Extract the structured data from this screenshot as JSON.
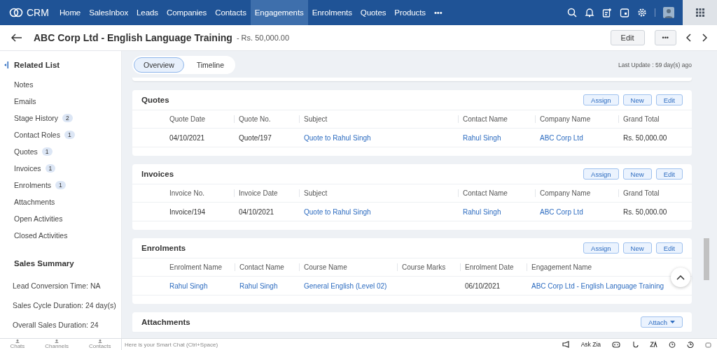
{
  "nav": {
    "brand": "CRM",
    "items": [
      {
        "label": "Home",
        "selected": false
      },
      {
        "label": "SalesInbox",
        "selected": false
      },
      {
        "label": "Leads",
        "selected": false
      },
      {
        "label": "Companies",
        "selected": false
      },
      {
        "label": "Contacts",
        "selected": false
      },
      {
        "label": "Engagements",
        "selected": true
      },
      {
        "label": "Enrolments",
        "selected": false
      },
      {
        "label": "Quotes",
        "selected": false
      },
      {
        "label": "Products",
        "selected": false
      }
    ],
    "more": "•••"
  },
  "header": {
    "title": "ABC Corp Ltd - English Language Training",
    "amount": "- Rs. 50,000.00",
    "edit": "Edit",
    "more": "•••"
  },
  "sidebar": {
    "title": "Related List",
    "items": [
      {
        "label": "Notes"
      },
      {
        "label": "Emails"
      },
      {
        "label": "Stage History",
        "count": "2"
      },
      {
        "label": "Contact Roles",
        "count": "1"
      },
      {
        "label": "Quotes",
        "count": "1"
      },
      {
        "label": "Invoices",
        "count": "1"
      },
      {
        "label": "Enrolments",
        "count": "1"
      },
      {
        "label": "Attachments"
      },
      {
        "label": "Open Activities"
      },
      {
        "label": "Closed Activities"
      }
    ],
    "summary_title": "Sales Summary",
    "summary": [
      "Lead Conversion Time: NA",
      "Sales Cycle Duration: 24 day(s)",
      "Overall Sales Duration: 24"
    ]
  },
  "tabs": [
    {
      "label": "Overview",
      "selected": true
    },
    {
      "label": "Timeline",
      "selected": false
    }
  ],
  "last_update": "Last Update : 59 day(s) ago",
  "sections": [
    {
      "title": "Quotes",
      "buttons": [
        "Assign",
        "New",
        "Edit"
      ],
      "columns": [
        "Quote Date",
        "Quote No.",
        "Subject",
        "Contact Name",
        "Company Name",
        "Grand Total"
      ],
      "rows": [
        [
          {
            "text": "04/10/2021",
            "kind": "text"
          },
          {
            "text": "Quote/197",
            "kind": "text"
          },
          {
            "text": "Quote to Rahul Singh",
            "kind": "link"
          },
          {
            "text": "Rahul Singh",
            "kind": "link"
          },
          {
            "text": "ABC Corp Ltd",
            "kind": "link"
          },
          {
            "text": "Rs. 50,000.00",
            "kind": "text"
          }
        ]
      ]
    },
    {
      "title": "Invoices",
      "buttons": [
        "Assign",
        "New",
        "Edit"
      ],
      "columns": [
        "Invoice No.",
        "Invoice Date",
        "Subject",
        "Contact Name",
        "Company Name",
        "Grand Total"
      ],
      "rows": [
        [
          {
            "text": "Invoice/194",
            "kind": "text"
          },
          {
            "text": "04/10/2021",
            "kind": "text"
          },
          {
            "text": "Quote to Rahul Singh",
            "kind": "link"
          },
          {
            "text": "Rahul Singh",
            "kind": "link"
          },
          {
            "text": "ABC Corp Ltd",
            "kind": "link"
          },
          {
            "text": "Rs. 50,000.00",
            "kind": "text"
          }
        ]
      ]
    },
    {
      "title": "Enrolments",
      "buttons": [
        "Assign",
        "New",
        "Edit"
      ],
      "columns": [
        "Enrolment Name",
        "Contact Name",
        "Course Name",
        "Course Marks",
        "Enrolment Date",
        "Engagement Name"
      ],
      "rows": [
        [
          {
            "text": "Rahul Singh",
            "kind": "link"
          },
          {
            "text": "Rahul Singh",
            "kind": "link"
          },
          {
            "text": "General English (Level 02)",
            "kind": "link"
          },
          {
            "kind": "text"
          },
          {
            "text": "06/10/2021",
            "kind": "text"
          },
          {
            "text": "ABC Corp Ltd - English Language Training",
            "kind": "link"
          }
        ]
      ]
    },
    {
      "title": "Attachments",
      "attach": "Attach"
    }
  ],
  "bottom": {
    "apps": [
      "Chats",
      "Channels",
      "Contacts"
    ],
    "chat_placeholder": "Here is your Smart Chat (Ctrl+Space)",
    "ask_zia": "Ask Zia"
  }
}
